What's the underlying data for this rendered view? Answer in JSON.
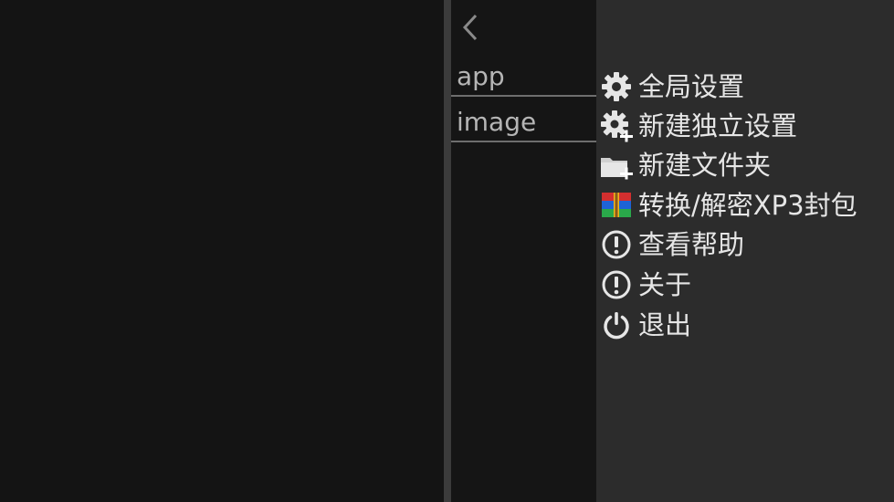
{
  "file_list": {
    "items": [
      {
        "label": "app"
      },
      {
        "label": "image"
      }
    ]
  },
  "menu": {
    "items": [
      {
        "label": "全局设置",
        "icon": "gear-icon"
      },
      {
        "label": "新建独立设置",
        "icon": "gear-add-icon"
      },
      {
        "label": "新建文件夹",
        "icon": "folder-add-icon"
      },
      {
        "label": "转换/解密XP3封包",
        "icon": "archive-icon"
      },
      {
        "label": "查看帮助",
        "icon": "info-icon"
      },
      {
        "label": "关于",
        "icon": "info-icon"
      },
      {
        "label": "退出",
        "icon": "power-icon"
      }
    ]
  },
  "colors": {
    "background": "#141414",
    "menu_background": "#2c2c2c",
    "divider": "#3b3b3b",
    "text": "#e6e6e6",
    "file_text": "#b5b5b5"
  }
}
